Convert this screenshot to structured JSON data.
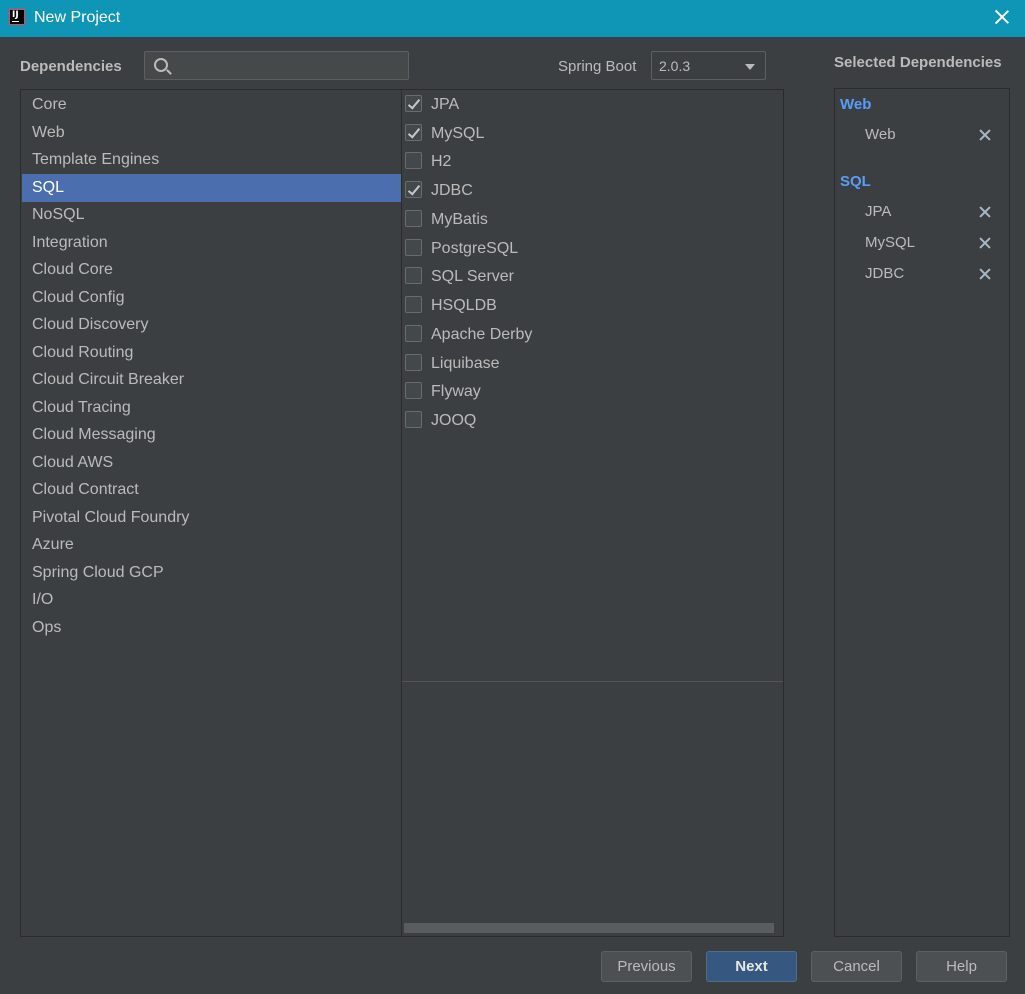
{
  "window": {
    "title": "New Project"
  },
  "header": {
    "dependencies_label": "Dependencies",
    "search_value": "",
    "spring_boot_label": "Spring Boot",
    "spring_boot_version": "2.0.3",
    "selected_title": "Selected Dependencies"
  },
  "categories": [
    "Core",
    "Web",
    "Template Engines",
    "SQL",
    "NoSQL",
    "Integration",
    "Cloud Core",
    "Cloud Config",
    "Cloud Discovery",
    "Cloud Routing",
    "Cloud Circuit Breaker",
    "Cloud Tracing",
    "Cloud Messaging",
    "Cloud AWS",
    "Cloud Contract",
    "Pivotal Cloud Foundry",
    "Azure",
    "Spring Cloud GCP",
    "I/O",
    "Ops"
  ],
  "selected_category": "SQL",
  "sql_dependencies": [
    {
      "label": "JPA",
      "checked": true
    },
    {
      "label": "MySQL",
      "checked": true
    },
    {
      "label": "H2",
      "checked": false
    },
    {
      "label": "JDBC",
      "checked": true
    },
    {
      "label": "MyBatis",
      "checked": false
    },
    {
      "label": "PostgreSQL",
      "checked": false
    },
    {
      "label": "SQL Server",
      "checked": false
    },
    {
      "label": "HSQLDB",
      "checked": false
    },
    {
      "label": "Apache Derby",
      "checked": false
    },
    {
      "label": "Liquibase",
      "checked": false
    },
    {
      "label": "Flyway",
      "checked": false
    },
    {
      "label": "JOOQ",
      "checked": false
    }
  ],
  "selected": [
    {
      "group": "Web",
      "items": [
        "Web"
      ]
    },
    {
      "group": "SQL",
      "items": [
        "JPA",
        "MySQL",
        "JDBC"
      ]
    }
  ],
  "buttons": {
    "previous": "Previous",
    "next": "Next",
    "cancel": "Cancel",
    "help": "Help"
  },
  "colors": {
    "accent": "#0f95b6",
    "selection": "#4b6eaf",
    "group_title": "#589df6",
    "background": "#3c3f41"
  },
  "icons": {
    "app": "intellij-icon",
    "close": "close-icon",
    "search": "search-icon",
    "dropdown": "chevron-down-icon",
    "remove": "remove-icon"
  }
}
